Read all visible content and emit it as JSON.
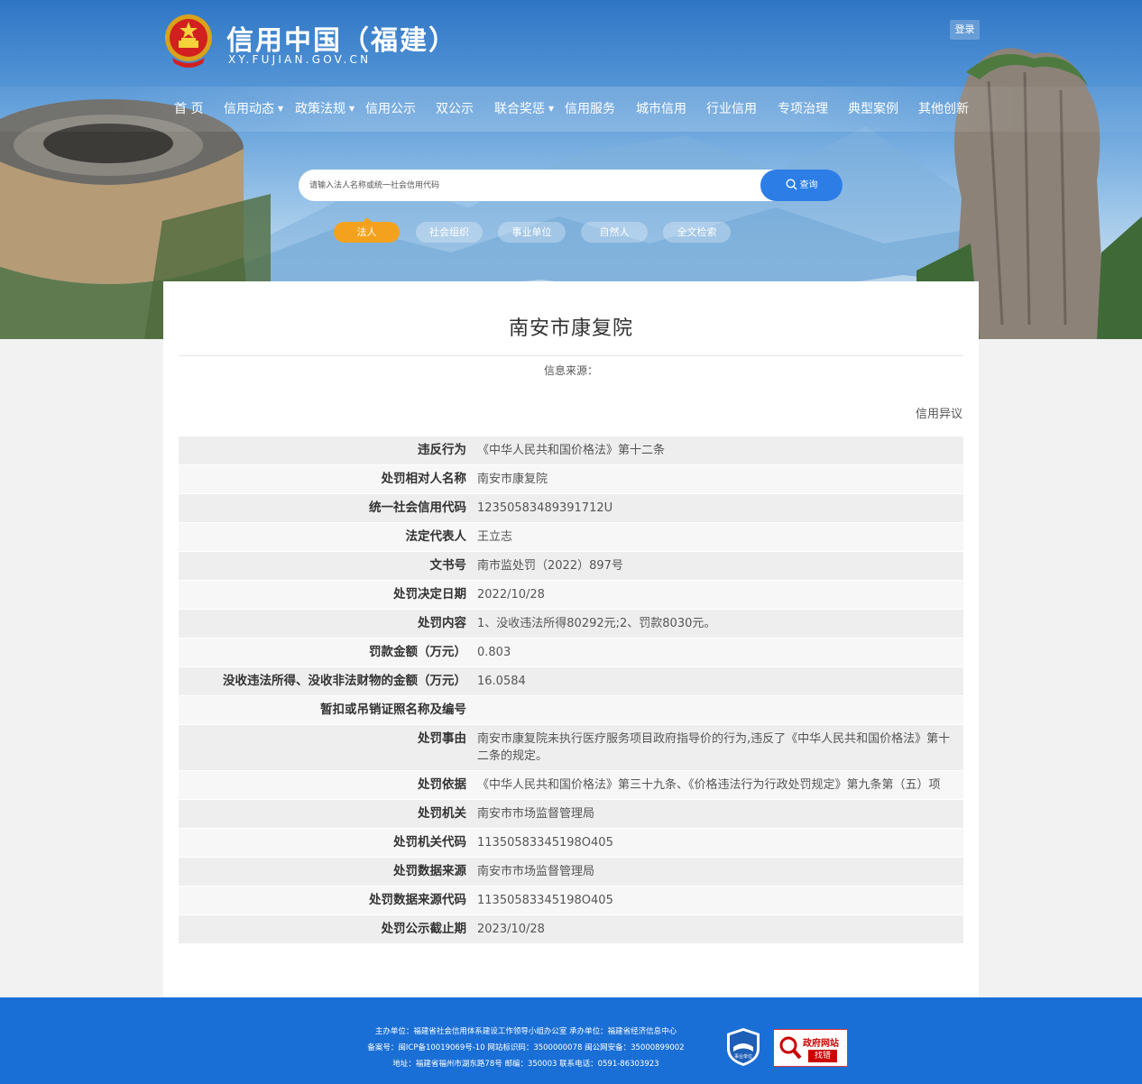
{
  "header": {
    "site_title": "信用中国（福建）",
    "site_domain": "XY.FUJIAN.GOV.CN",
    "login_label": "登录"
  },
  "nav": {
    "items": [
      {
        "label": "首 页",
        "dropdown": false
      },
      {
        "label": "信用动态",
        "dropdown": true
      },
      {
        "label": "政策法规",
        "dropdown": true
      },
      {
        "label": "信用公示",
        "dropdown": false
      },
      {
        "label": "双公示",
        "dropdown": false
      },
      {
        "label": "联合奖惩",
        "dropdown": true
      },
      {
        "label": "信用服务",
        "dropdown": false
      },
      {
        "label": "城市信用",
        "dropdown": false
      },
      {
        "label": "行业信用",
        "dropdown": false
      },
      {
        "label": "专项治理",
        "dropdown": false
      },
      {
        "label": "典型案例",
        "dropdown": false
      },
      {
        "label": "其他创新",
        "dropdown": false
      }
    ]
  },
  "search": {
    "placeholder": "请输入法人名称或统一社会信用代码",
    "button_label": "查询",
    "categories": [
      "法人",
      "社会组织",
      "事业单位",
      "自然人",
      "全文检索"
    ],
    "active_category": "法人"
  },
  "detail": {
    "title": "南安市康复院",
    "source_label": "信息来源：",
    "objection_label": "信用异议",
    "rows": [
      {
        "label": "违反行为",
        "value": "《中华人民共和国价格法》第十二条"
      },
      {
        "label": "处罚相对人名称",
        "value": "南安市康复院"
      },
      {
        "label": "统一社会信用代码",
        "value": "12350583489391712U"
      },
      {
        "label": "法定代表人",
        "value": "王立志"
      },
      {
        "label": "文书号",
        "value": "南市监处罚（2022）897号"
      },
      {
        "label": "处罚决定日期",
        "value": "2022/10/28"
      },
      {
        "label": "处罚内容",
        "value": "1、没收违法所得80292元;2、罚款8030元。"
      },
      {
        "label": "罚款金额（万元）",
        "value": "0.803"
      },
      {
        "label": "没收违法所得、没收非法财物的金额（万元）",
        "value": "16.0584"
      },
      {
        "label": "暂扣或吊销证照名称及编号",
        "value": ""
      },
      {
        "label": "处罚事由",
        "value": "南安市康复院未执行医疗服务项目政府指导价的行为,违反了《中华人民共和国价格法》第十二条的规定。"
      },
      {
        "label": "处罚依据",
        "value": "《中华人民共和国价格法》第三十九条、《价格违法行为行政处罚规定》第九条第（五）项"
      },
      {
        "label": "处罚机关",
        "value": "南安市市场监督管理局"
      },
      {
        "label": "处罚机关代码",
        "value": "11350583345198O405"
      },
      {
        "label": "处罚数据来源",
        "value": "南安市市场监督管理局"
      },
      {
        "label": "处罚数据来源代码",
        "value": "11350583345198O405"
      },
      {
        "label": "处罚公示截止期",
        "value": "2023/10/28"
      }
    ]
  },
  "footer": {
    "line1": "主办单位：福建省社会信用体系建设工作领导小组办公室    承办单位：福建省经济信息中心",
    "line2": "备案号：闽ICP备10019069号-10    网站标识码：3500000078    闽公网安备：35000899002",
    "line3": "地址：福建省福州市湖东路78号    邮编：350003    联系电话：0591-86303923",
    "badge_label": "事业单位",
    "gov_label": "政府网站",
    "gov_sub_label": "找错"
  },
  "colors": {
    "nav_accent": "#f4a21e",
    "search_button": "#2c7ee6",
    "footer_bg": "#1a6fd6"
  }
}
